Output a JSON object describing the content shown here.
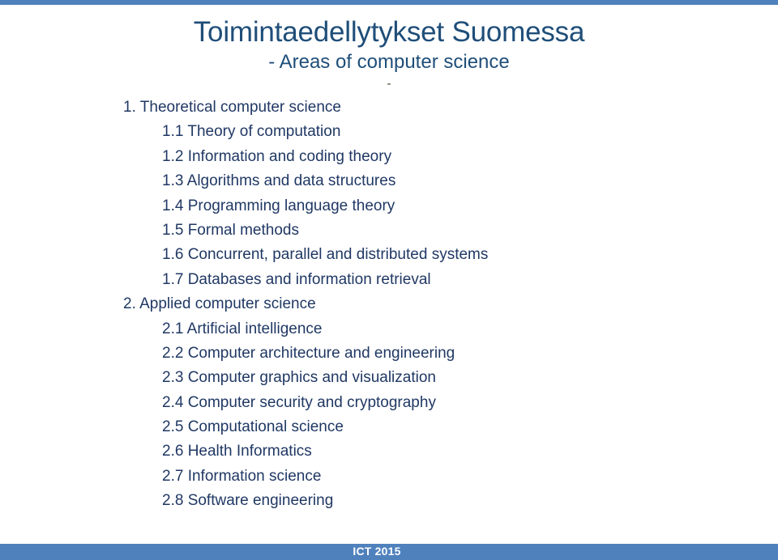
{
  "slide": {
    "title": "Toimintaedellytykset Suomessa",
    "subtitle": "- Areas of computer science",
    "subtitle_dash": "-",
    "accent_color": "#4F81BD",
    "title_color": "#1F4E79",
    "body_color": "#203864",
    "background_color": "#FFFFFF"
  },
  "outline": [
    {
      "text": "1. Theoretical computer science",
      "level": 1
    },
    {
      "text": "1.1 Theory of computation",
      "level": 2
    },
    {
      "text": "1.2 Information and coding theory",
      "level": 2
    },
    {
      "text": "1.3 Algorithms and data structures",
      "level": 2
    },
    {
      "text": "1.4 Programming language theory",
      "level": 2
    },
    {
      "text": "1.5 Formal methods",
      "level": 2
    },
    {
      "text": "1.6 Concurrent, parallel and distributed systems",
      "level": 2
    },
    {
      "text": "1.7 Databases and information retrieval",
      "level": 2
    },
    {
      "text": "2. Applied computer science",
      "level": 1
    },
    {
      "text": "2.1 Artificial intelligence",
      "level": 2
    },
    {
      "text": "2.2 Computer architecture and engineering",
      "level": 2
    },
    {
      "text": "2.3 Computer graphics and visualization",
      "level": 2
    },
    {
      "text": "2.4 Computer security and cryptography",
      "level": 2
    },
    {
      "text": "2.5 Computational science",
      "level": 2
    },
    {
      "text": "2.6 Health Informatics",
      "level": 2
    },
    {
      "text": "2.7 Information science",
      "level": 2
    },
    {
      "text": "2.8 Software engineering",
      "level": 2
    }
  ],
  "footer": {
    "label": "ICT 2015"
  }
}
